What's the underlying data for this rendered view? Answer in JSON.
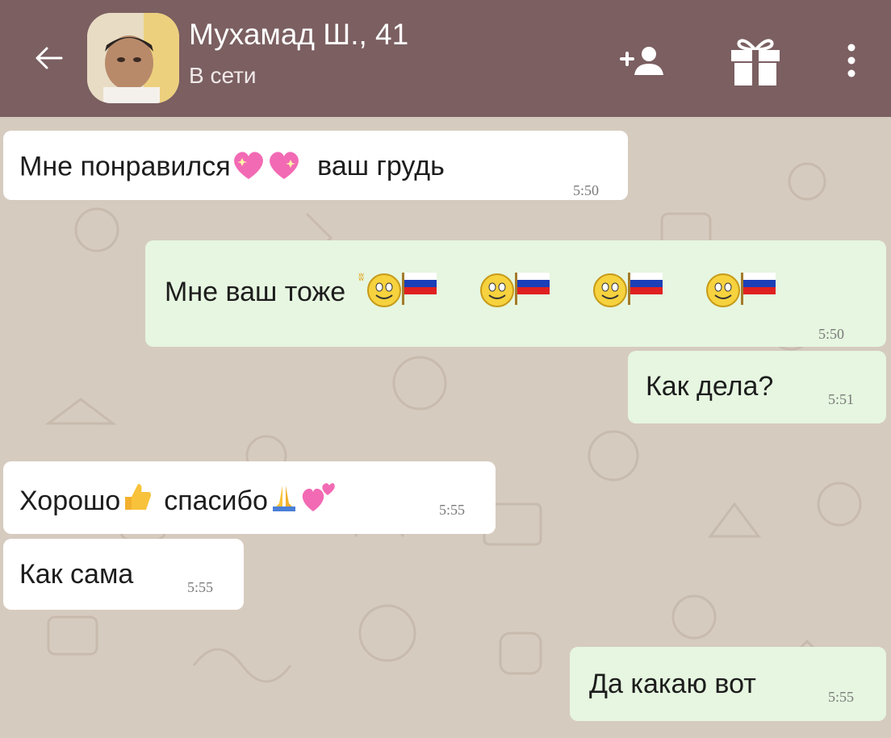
{
  "header": {
    "contact_name": "Мухамад Ш., 41",
    "status": "В сети",
    "colors": {
      "bar": "#7b5f61",
      "text": "#ffffff"
    },
    "icons": [
      "back-arrow-icon",
      "avatar",
      "add-user-icon",
      "gift-icon",
      "more-vert-icon"
    ]
  },
  "messages": [
    {
      "direction": "in",
      "text": "Мне понравился",
      "text_after": "ваш грудь",
      "emoji": [
        "sparkling-heart",
        "sparkling-heart"
      ],
      "time": "5:50"
    },
    {
      "direction": "out",
      "text": "Мне ваш тоже",
      "emoji": [
        "waving-smiley-russian-flag",
        "waving-smiley-russian-flag",
        "waving-smiley-russian-flag",
        "waving-smiley-russian-flag"
      ],
      "time": "5:50"
    },
    {
      "direction": "out",
      "text": "Как дела?",
      "time": "5:51"
    },
    {
      "direction": "in",
      "text": "Хорошо",
      "text_after": "спасибо",
      "emoji": [
        "thumbs-up",
        "folded-hands",
        "two-hearts"
      ],
      "time": "5:55"
    },
    {
      "direction": "in",
      "text": "Как сама",
      "time": "5:55"
    },
    {
      "direction": "out",
      "text": "Да какаю вот",
      "time": "5:55"
    }
  ],
  "colors": {
    "incoming_bubble": "#ffffff",
    "outgoing_bubble": "#e6f6e0",
    "wallpaper": "#d6cbbf"
  }
}
